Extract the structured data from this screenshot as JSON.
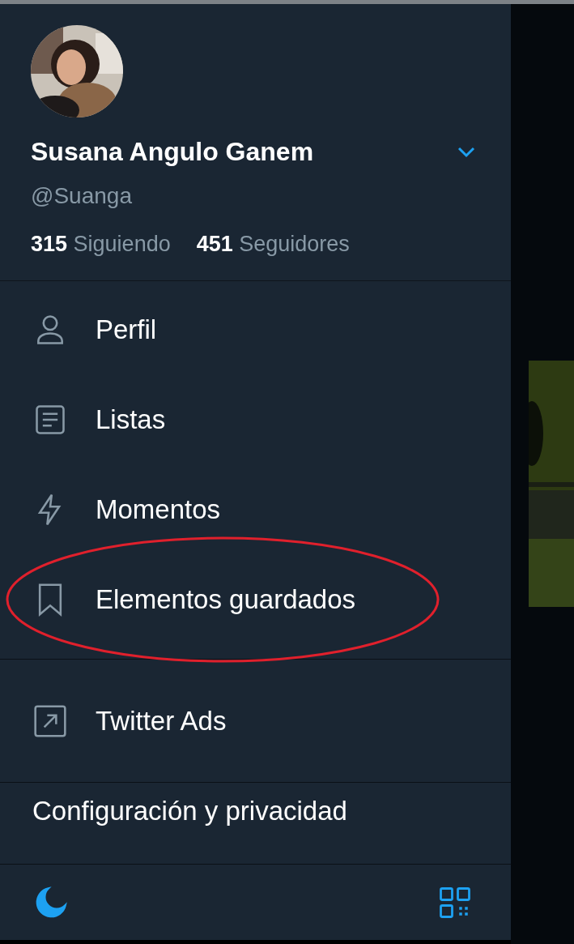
{
  "profile": {
    "name": "Susana Angulo Ganem",
    "handle": "@Suanga",
    "stats": [
      {
        "count": "315",
        "label": "Siguiendo"
      },
      {
        "count": "451",
        "label": "Seguidores"
      }
    ]
  },
  "menu": [
    {
      "label": "Perfil",
      "kind": "person",
      "highlighted": false
    },
    {
      "label": "Listas",
      "kind": "list",
      "highlighted": false
    },
    {
      "label": "Momentos",
      "kind": "bolt",
      "highlighted": false
    },
    {
      "label": "Elementos guardados",
      "kind": "bookmark",
      "highlighted": true
    }
  ],
  "secondary_menu": [
    {
      "label": "Twitter Ads",
      "kind": "external"
    }
  ],
  "settings_item": {
    "label": "Configuración y privacidad"
  },
  "footer": {
    "night_mode": true
  }
}
